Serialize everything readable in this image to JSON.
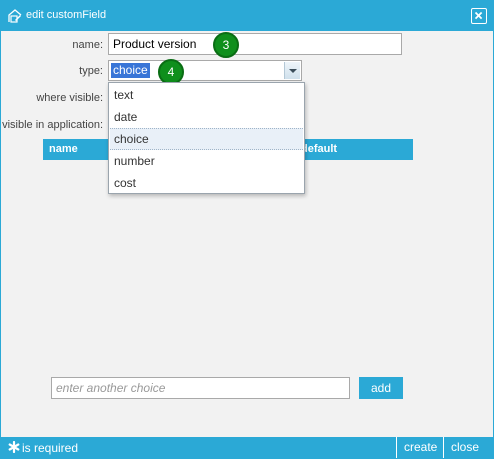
{
  "dialog": {
    "title": "edit customField",
    "title_icon": "edit-icon",
    "close_icon": "close-icon"
  },
  "form": {
    "name_label": "name:",
    "name_value": "Product version",
    "type_label": "type:",
    "type_value": "choice",
    "where_visible_label": "where visible:",
    "visible_in_app_label": "visible in application:"
  },
  "badges": {
    "name_step": "3",
    "type_step": "4"
  },
  "table": {
    "col_name": "name",
    "col_default": "default"
  },
  "dropdown": {
    "options": [
      "text",
      "date",
      "choice",
      "number",
      "cost"
    ],
    "selected_index": 2
  },
  "choice_entry": {
    "placeholder": "enter another choice",
    "add_label": "add"
  },
  "footer": {
    "required_icon": "asterisk-icon",
    "required_text": "is required",
    "create_label": "create",
    "close_label": "close"
  },
  "colors": {
    "accent": "#2ba9d6",
    "badge": "#0f8f1c",
    "selection": "#3875d7"
  }
}
